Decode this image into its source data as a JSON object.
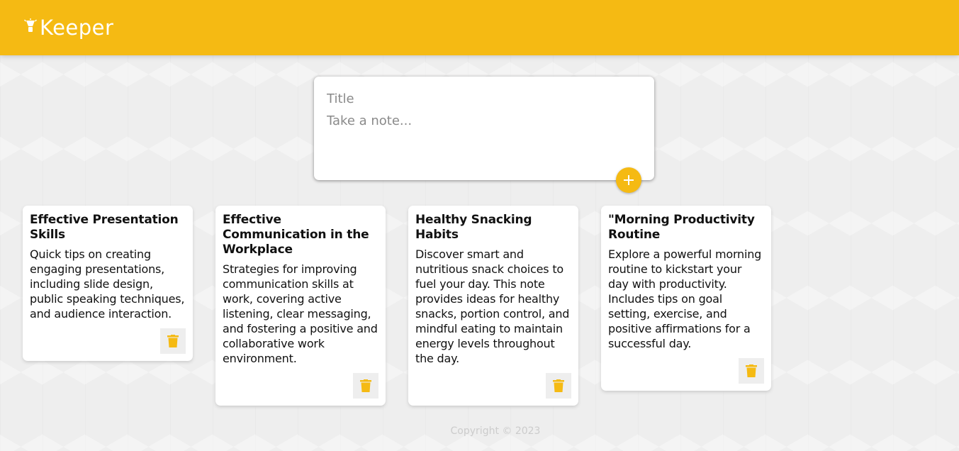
{
  "header": {
    "logo_icon": "lightbulb-icon",
    "title": "Keeper"
  },
  "create_note": {
    "title_placeholder": "Title",
    "content_placeholder": "Take a note...",
    "add_icon": "plus-icon"
  },
  "notes": [
    {
      "title": "Effective Presentation Skills",
      "content": "Quick tips on creating engaging presentations, including slide design, public speaking techniques, and audience interaction.",
      "delete_icon": "trash-icon"
    },
    {
      "title": "Effective Communication in the Workplace",
      "content": "Strategies for improving communication skills at work, covering active listening, clear messaging, and fostering a positive and collaborative work environment.",
      "delete_icon": "trash-icon"
    },
    {
      "title": "Healthy Snacking Habits",
      "content": "Discover smart and nutritious snack choices to fuel your day. This note provides ideas for healthy snacks, portion control, and mindful eating to maintain energy levels throughout the day.",
      "delete_icon": "trash-icon"
    },
    {
      "title": "\"Morning Productivity Routine",
      "content": "Explore a powerful morning routine to kickstart your day with productivity. Includes tips on goal setting, exercise, and positive affirmations for a successful day.",
      "delete_icon": "trash-icon"
    }
  ],
  "footer": {
    "copyright": "Copyright © 2023"
  },
  "colors": {
    "brand": "#f5ba13",
    "background": "#eeeeee",
    "card": "#ffffff",
    "footer_text": "#cccccc"
  }
}
